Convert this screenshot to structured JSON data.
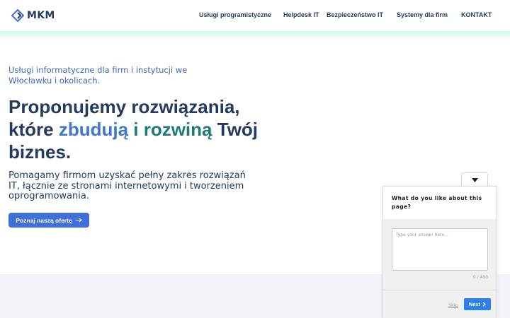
{
  "header": {
    "logo_text": "MKM",
    "nav": [
      {
        "label": "Usługi programistyczne"
      },
      {
        "label": "Helpdesk IT"
      },
      {
        "label": "Bezpieczeństwo IT"
      },
      {
        "label": "Systemy dla firm"
      },
      {
        "label": "KONTAKT"
      }
    ]
  },
  "hero": {
    "subtitle": "Usługi informatyczne dla firm i instytucji we Włocławku i okolicach.",
    "title_part1": "Proponujemy rozwiązania, które ",
    "title_highlight1": "zbudują",
    "title_space": " ",
    "title_highlight2": "i rozwiną",
    "title_part2": " Twój biznes.",
    "description": "Pomagamy firmom uzyskać pełny zakres rozwiązań IT, łącznie ze stronami internetowymi i tworzeniem oprogramowania.",
    "cta_label": "Poznaj naszą ofertę",
    "colors": {
      "accent": "#3f6fd8",
      "highlight_blue": "#3f78c9",
      "highlight_green": "#1d7a78"
    }
  },
  "survey": {
    "question": "What do you like about this page?",
    "placeholder": "Type your answer here...",
    "counter": "0 / 400",
    "skip_label": "Skip",
    "next_label": "Next",
    "next_color": "#2f80ed"
  }
}
